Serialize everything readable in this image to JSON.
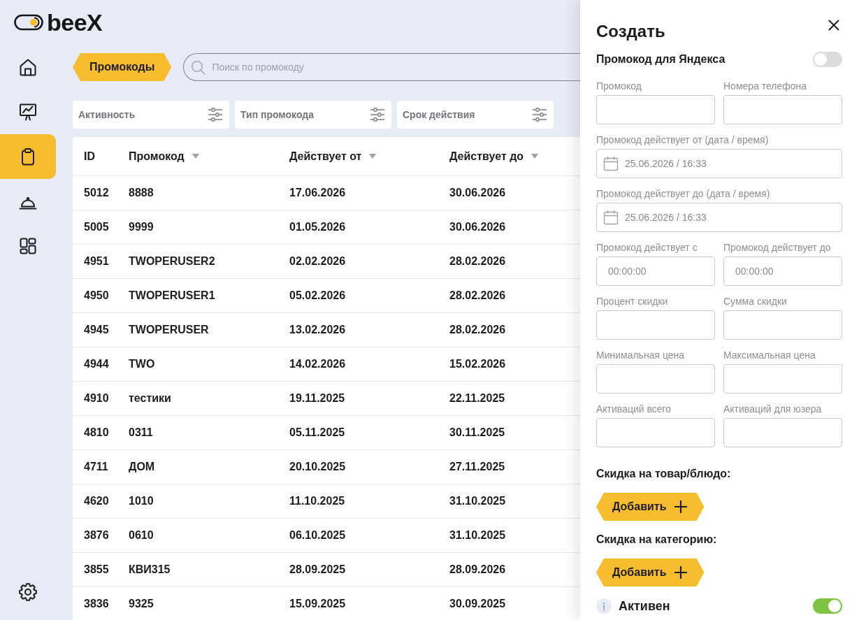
{
  "logo": {
    "text": "beeX"
  },
  "sidebar": {
    "items": [
      {
        "kind": "home",
        "selected": false
      },
      {
        "kind": "chart",
        "selected": false
      },
      {
        "kind": "clipboard",
        "selected": true
      },
      {
        "kind": "cloche",
        "selected": false
      },
      {
        "kind": "grid",
        "selected": false
      }
    ],
    "bottom_items": [
      {
        "kind": "gear",
        "selected": false
      }
    ]
  },
  "toolbar": {
    "section_tag": "Промокоды",
    "search": {
      "placeholder": "Поиск по промокоду"
    }
  },
  "filters": [
    {
      "label": "Активность"
    },
    {
      "label": "Тип промокода"
    },
    {
      "label": "Срок действия"
    }
  ],
  "table": {
    "columns": [
      {
        "label": "ID",
        "sortable": false
      },
      {
        "label": "Промокод",
        "sortable": true
      },
      {
        "label": "Действует от",
        "sortable": true
      },
      {
        "label": "Действует до",
        "sortable": true
      }
    ],
    "rows": [
      {
        "cells": [
          "5012",
          "8888",
          "17.06.2026",
          "30.06.2026"
        ]
      },
      {
        "cells": [
          "5005",
          "9999",
          "01.05.2026",
          "30.06.2026"
        ]
      },
      {
        "cells": [
          "4951",
          "TWOPERUSER2",
          "02.02.2026",
          "28.02.2026"
        ]
      },
      {
        "cells": [
          "4950",
          "TWOPERUSER1",
          "05.02.2026",
          "28.02.2026"
        ]
      },
      {
        "cells": [
          "4945",
          "TWOPERUSER",
          "13.02.2026",
          "28.02.2026"
        ]
      },
      {
        "cells": [
          "4944",
          "TWO",
          "14.02.2026",
          "15.02.2026"
        ]
      },
      {
        "cells": [
          "4910",
          "тестики",
          "19.11.2025",
          "22.11.2025"
        ]
      },
      {
        "cells": [
          "4810",
          "0311",
          "05.11.2025",
          "30.11.2025"
        ]
      },
      {
        "cells": [
          "4711",
          "ДОМ",
          "20.10.2025",
          "27.11.2025"
        ]
      },
      {
        "cells": [
          "4620",
          "1010",
          "11.10.2025",
          "31.10.2025"
        ]
      },
      {
        "cells": [
          "3876",
          "0610",
          "06.10.2025",
          "31.10.2025"
        ]
      },
      {
        "cells": [
          "3855",
          "КВИ315",
          "28.09.2025",
          "28.09.2026"
        ]
      },
      {
        "cells": [
          "3836",
          "9325",
          "15.09.2025",
          "30.09.2025"
        ]
      }
    ]
  },
  "panel": {
    "title": "Создать",
    "yandex_toggle": {
      "label": "Промокод для Яндекса",
      "on": false
    },
    "fields": [
      {
        "label": "Промокод",
        "kind": "text"
      },
      {
        "label": "Номера телефона",
        "kind": "text"
      },
      {
        "label": "Промокод действует от (дата / время)",
        "kind": "datetime",
        "value": "25.06.2026 / 16:33"
      },
      {
        "label": "Промокод действует до (дата / время)",
        "kind": "datetime",
        "value": "25.06.2026 / 16:33"
      },
      {
        "label": "Промокод действует с",
        "kind": "time",
        "value": "00:00:00"
      },
      {
        "label": "Промокод действует до",
        "kind": "time",
        "value": "00:00:00"
      },
      {
        "label": "Процент скидки",
        "kind": "text"
      },
      {
        "label": "Сумма скидки",
        "kind": "text"
      },
      {
        "label": "Минимальная цена",
        "kind": "text"
      },
      {
        "label": "Максимальная цена",
        "kind": "text"
      },
      {
        "label": "Активаций всего",
        "kind": "text"
      },
      {
        "label": "Активаций для юзера",
        "kind": "text"
      }
    ],
    "sections": [
      {
        "heading": "Скидка на товар/блюдо:",
        "button": "Добавить"
      },
      {
        "heading": "Скидка на категорию:",
        "button": "Добавить"
      }
    ],
    "active_toggle": {
      "label": "Активен",
      "on": true
    }
  }
}
